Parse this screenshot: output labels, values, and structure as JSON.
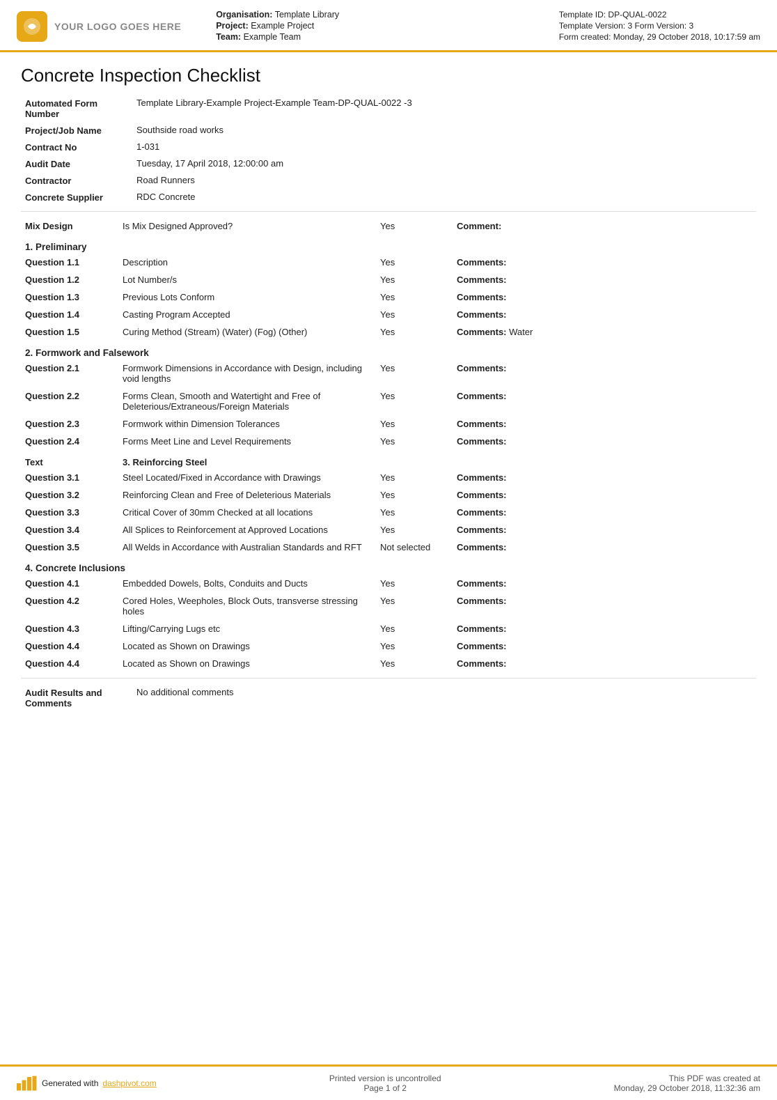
{
  "header": {
    "logo_text": "YOUR LOGO GOES HERE",
    "org_label": "Organisation:",
    "org_value": "Template Library",
    "project_label": "Project:",
    "project_value": "Example Project",
    "team_label": "Team:",
    "team_value": "Example Team",
    "template_id": "Template ID: DP-QUAL-0022",
    "template_version": "Template Version: 3  Form Version: 3",
    "form_created": "Form created: Monday, 29 October 2018, 10:17:59 am"
  },
  "doc": {
    "title": "Concrete Inspection Checklist",
    "fields": [
      {
        "label": "Automated Form Number",
        "value": "Template Library-Example Project-Example Team-DP-QUAL-0022  -3"
      },
      {
        "label": "Project/Job Name",
        "value": "Southside road works"
      },
      {
        "label": "Contract No",
        "value": "1-031"
      },
      {
        "label": "Audit Date",
        "value": "Tuesday, 17 April 2018, 12:00:00 am"
      },
      {
        "label": "Contractor",
        "value": "Road Runners"
      },
      {
        "label": "Concrete Supplier",
        "value": "RDC Concrete"
      }
    ],
    "mix_design": {
      "label": "Mix Design",
      "question": "Is Mix Designed Approved?",
      "answer": "Yes",
      "comment_label": "Comment:"
    },
    "sections": [
      {
        "id": "s1",
        "title": "1. Preliminary",
        "questions": [
          {
            "id": "q1.1",
            "label": "Question 1.1",
            "desc": "Description",
            "answer": "Yes",
            "comment": "Comments:"
          },
          {
            "id": "q1.2",
            "label": "Question 1.2",
            "desc": "Lot Number/s",
            "answer": "Yes",
            "comment": "Comments:"
          },
          {
            "id": "q1.3",
            "label": "Question 1.3",
            "desc": "Previous Lots Conform",
            "answer": "Yes",
            "comment": "Comments:"
          },
          {
            "id": "q1.4",
            "label": "Question 1.4",
            "desc": "Casting Program Accepted",
            "answer": "Yes",
            "comment": "Comments:"
          },
          {
            "id": "q1.5",
            "label": "Question 1.5",
            "desc": "Curing Method (Stream) (Water) (Fog) (Other)",
            "answer": "Yes",
            "comment": "Comments:",
            "comment_value": " Water"
          }
        ]
      },
      {
        "id": "s2",
        "title": "2. Formwork and Falsework",
        "questions": [
          {
            "id": "q2.1",
            "label": "Question 2.1",
            "desc": "Formwork Dimensions in Accordance with Design, including void lengths",
            "answer": "Yes",
            "comment": "Comments:"
          },
          {
            "id": "q2.2",
            "label": "Question 2.2",
            "desc": "Forms Clean, Smooth and Watertight and Free of Deleterious/Extraneous/Foreign Materials",
            "answer": "Yes",
            "comment": "Comments:"
          },
          {
            "id": "q2.3",
            "label": "Question 2.3",
            "desc": "Formwork within Dimension Tolerances",
            "answer": "Yes",
            "comment": "Comments:"
          },
          {
            "id": "q2.4",
            "label": "Question 2.4",
            "desc": "Forms Meet Line and Level Requirements",
            "answer": "Yes",
            "comment": "Comments:"
          }
        ]
      },
      {
        "id": "s3",
        "title": "3. Reinforcing Steel",
        "title_label": "Text",
        "questions": [
          {
            "id": "q3.1",
            "label": "Question 3.1",
            "desc": "Steel Located/Fixed in Accordance with Drawings",
            "answer": "Yes",
            "comment": "Comments:"
          },
          {
            "id": "q3.2",
            "label": "Question 3.2",
            "desc": "Reinforcing Clean and Free of Deleterious Materials",
            "answer": "Yes",
            "comment": "Comments:"
          },
          {
            "id": "q3.3",
            "label": "Question 3.3",
            "desc": "Critical Cover of 30mm Checked at all locations",
            "answer": "Yes",
            "comment": "Comments:"
          },
          {
            "id": "q3.4",
            "label": "Question 3.4",
            "desc": "All Splices to Reinforcement at Approved Locations",
            "answer": "Yes",
            "comment": "Comments:"
          },
          {
            "id": "q3.5",
            "label": "Question 3.5",
            "desc": "All Welds in Accordance with Australian Standards and RFT",
            "answer": "Not selected",
            "comment": "Comments:"
          }
        ]
      },
      {
        "id": "s4",
        "title": "4. Concrete Inclusions",
        "questions": [
          {
            "id": "q4.1",
            "label": "Question 4.1",
            "desc": "Embedded Dowels, Bolts, Conduits and Ducts",
            "answer": "Yes",
            "comment": "Comments:"
          },
          {
            "id": "q4.2",
            "label": "Question 4.2",
            "desc": "Cored Holes, Weepholes, Block Outs, transverse stressing holes",
            "answer": "Yes",
            "comment": "Comments:"
          },
          {
            "id": "q4.3",
            "label": "Question 4.3",
            "desc": "Lifting/Carrying Lugs etc",
            "answer": "Yes",
            "comment": "Comments:"
          },
          {
            "id": "q4.4a",
            "label": "Question 4.4",
            "desc": "Located as Shown on Drawings",
            "answer": "Yes",
            "comment": "Comments:"
          },
          {
            "id": "q4.4b",
            "label": "Question 4.4",
            "desc": "Located as Shown on Drawings",
            "answer": "Yes",
            "comment": "Comments:"
          }
        ]
      }
    ],
    "audit_results": {
      "label": "Audit Results and Comments",
      "value": "No additional comments"
    }
  },
  "footer": {
    "generated_text": "Generated with ",
    "link_text": "dashpivot.com",
    "center_line1": "Printed version is uncontrolled",
    "center_line2": "Page 1 of 2",
    "right_line1": "This PDF was created at",
    "right_line2": "Monday, 29 October 2018, 11:32:36 am"
  }
}
